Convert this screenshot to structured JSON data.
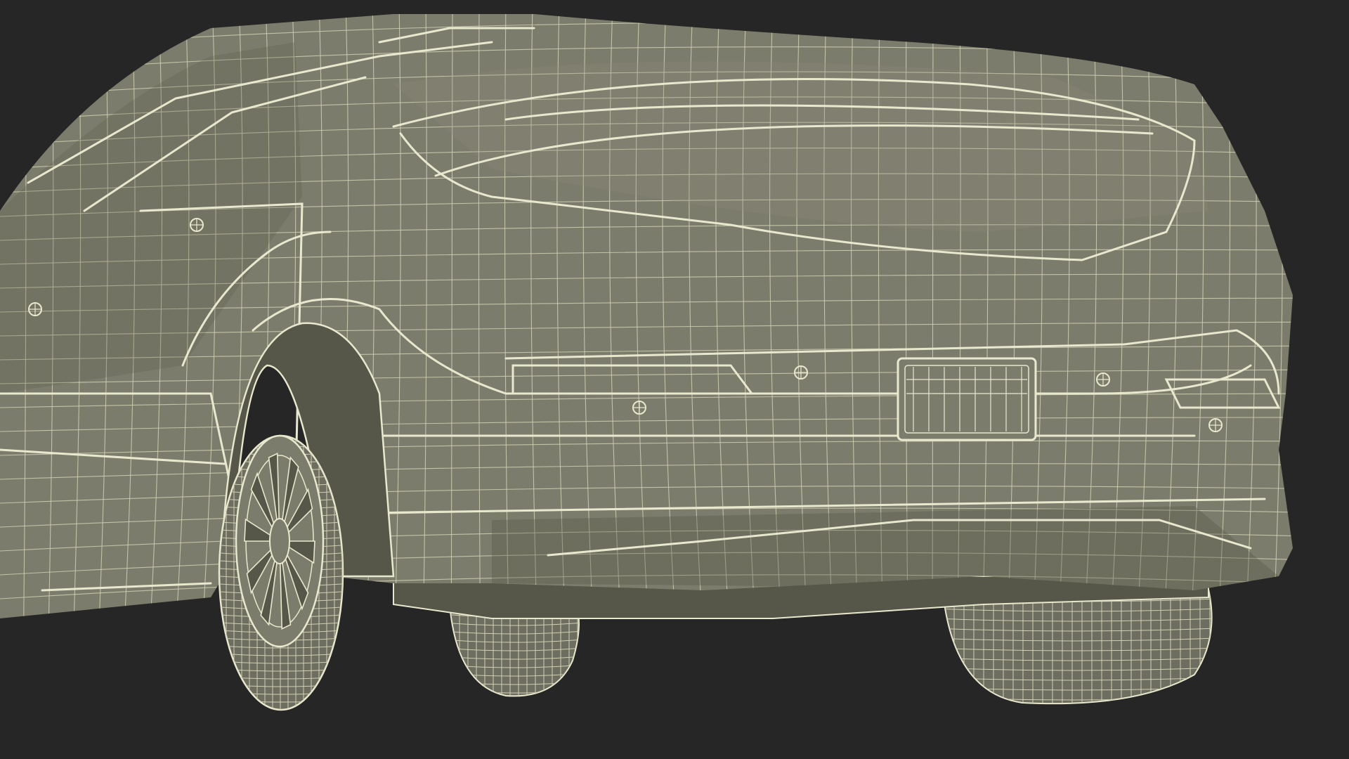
{
  "scene": {
    "background_color": "#262626",
    "surface_color": "#7c7c6c",
    "surface_shadow_color": "#565649",
    "surface_highlight_color": "#8e8d7c",
    "tire_color": "#6e6e60",
    "wire_color": "#e8e8cf",
    "wire_color_dim": "#cfcfb4"
  }
}
